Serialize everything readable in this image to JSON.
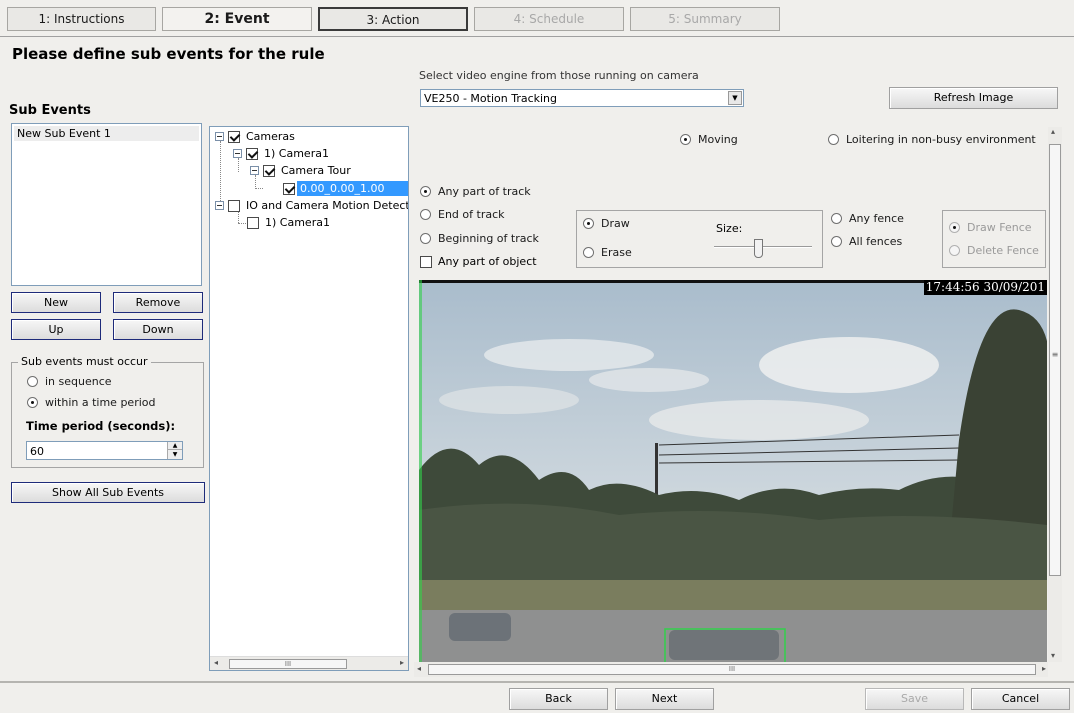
{
  "tabs": [
    {
      "label": "1: Instructions"
    },
    {
      "label": "2: Event"
    },
    {
      "label": "3: Action"
    },
    {
      "label": "4: Schedule"
    },
    {
      "label": "5: Summary"
    }
  ],
  "page_title": "Please define sub events for the rule",
  "sub_events": {
    "heading": "Sub Events",
    "items": [
      "New Sub Event 1"
    ],
    "buttons": {
      "new": "New",
      "remove": "Remove",
      "up": "Up",
      "down": "Down"
    },
    "occur_group": {
      "legend": "Sub events must occur",
      "in_sequence": "in sequence",
      "within_period": "within a time period",
      "period_label": "Time period (seconds):",
      "period_value": "60"
    },
    "show_all": "Show All Sub Events"
  },
  "tree": {
    "cameras": "Cameras",
    "camera1": "1) Camera1",
    "camera_tour": "Camera Tour",
    "preset": "0.00_0.00_1.00",
    "io_motion": "IO and Camera Motion Detection",
    "io_camera1": "1) Camera1"
  },
  "engine": {
    "label": "Select video engine from those running on camera",
    "value": "VE250 - Motion Tracking",
    "refresh": "Refresh Image"
  },
  "options": {
    "moving": "Moving",
    "loitering": "Loitering in non-busy environment",
    "any_part_track": "Any part of track",
    "end_track": "End of track",
    "beginning_track": "Beginning of track",
    "any_part_object": "Any part of object",
    "draw": "Draw",
    "erase": "Erase",
    "size": "Size:",
    "size_level": 0.45,
    "any_fence": "Any fence",
    "all_fences": "All fences",
    "draw_fence": "Draw Fence",
    "delete_fence": "Delete Fence"
  },
  "video": {
    "timestamp": "17:44:56 30/09/201"
  },
  "footer": {
    "back": "Back",
    "next": "Next",
    "save": "Save",
    "cancel": "Cancel"
  },
  "glyphs": {
    "scroll_grip": "III",
    "scroll_grip_v": "≡",
    "spin_up": "▲",
    "spin_down": "▼",
    "dropdown": "▼",
    "left": "◂",
    "right": "▸",
    "up": "▴",
    "down": "▾"
  }
}
